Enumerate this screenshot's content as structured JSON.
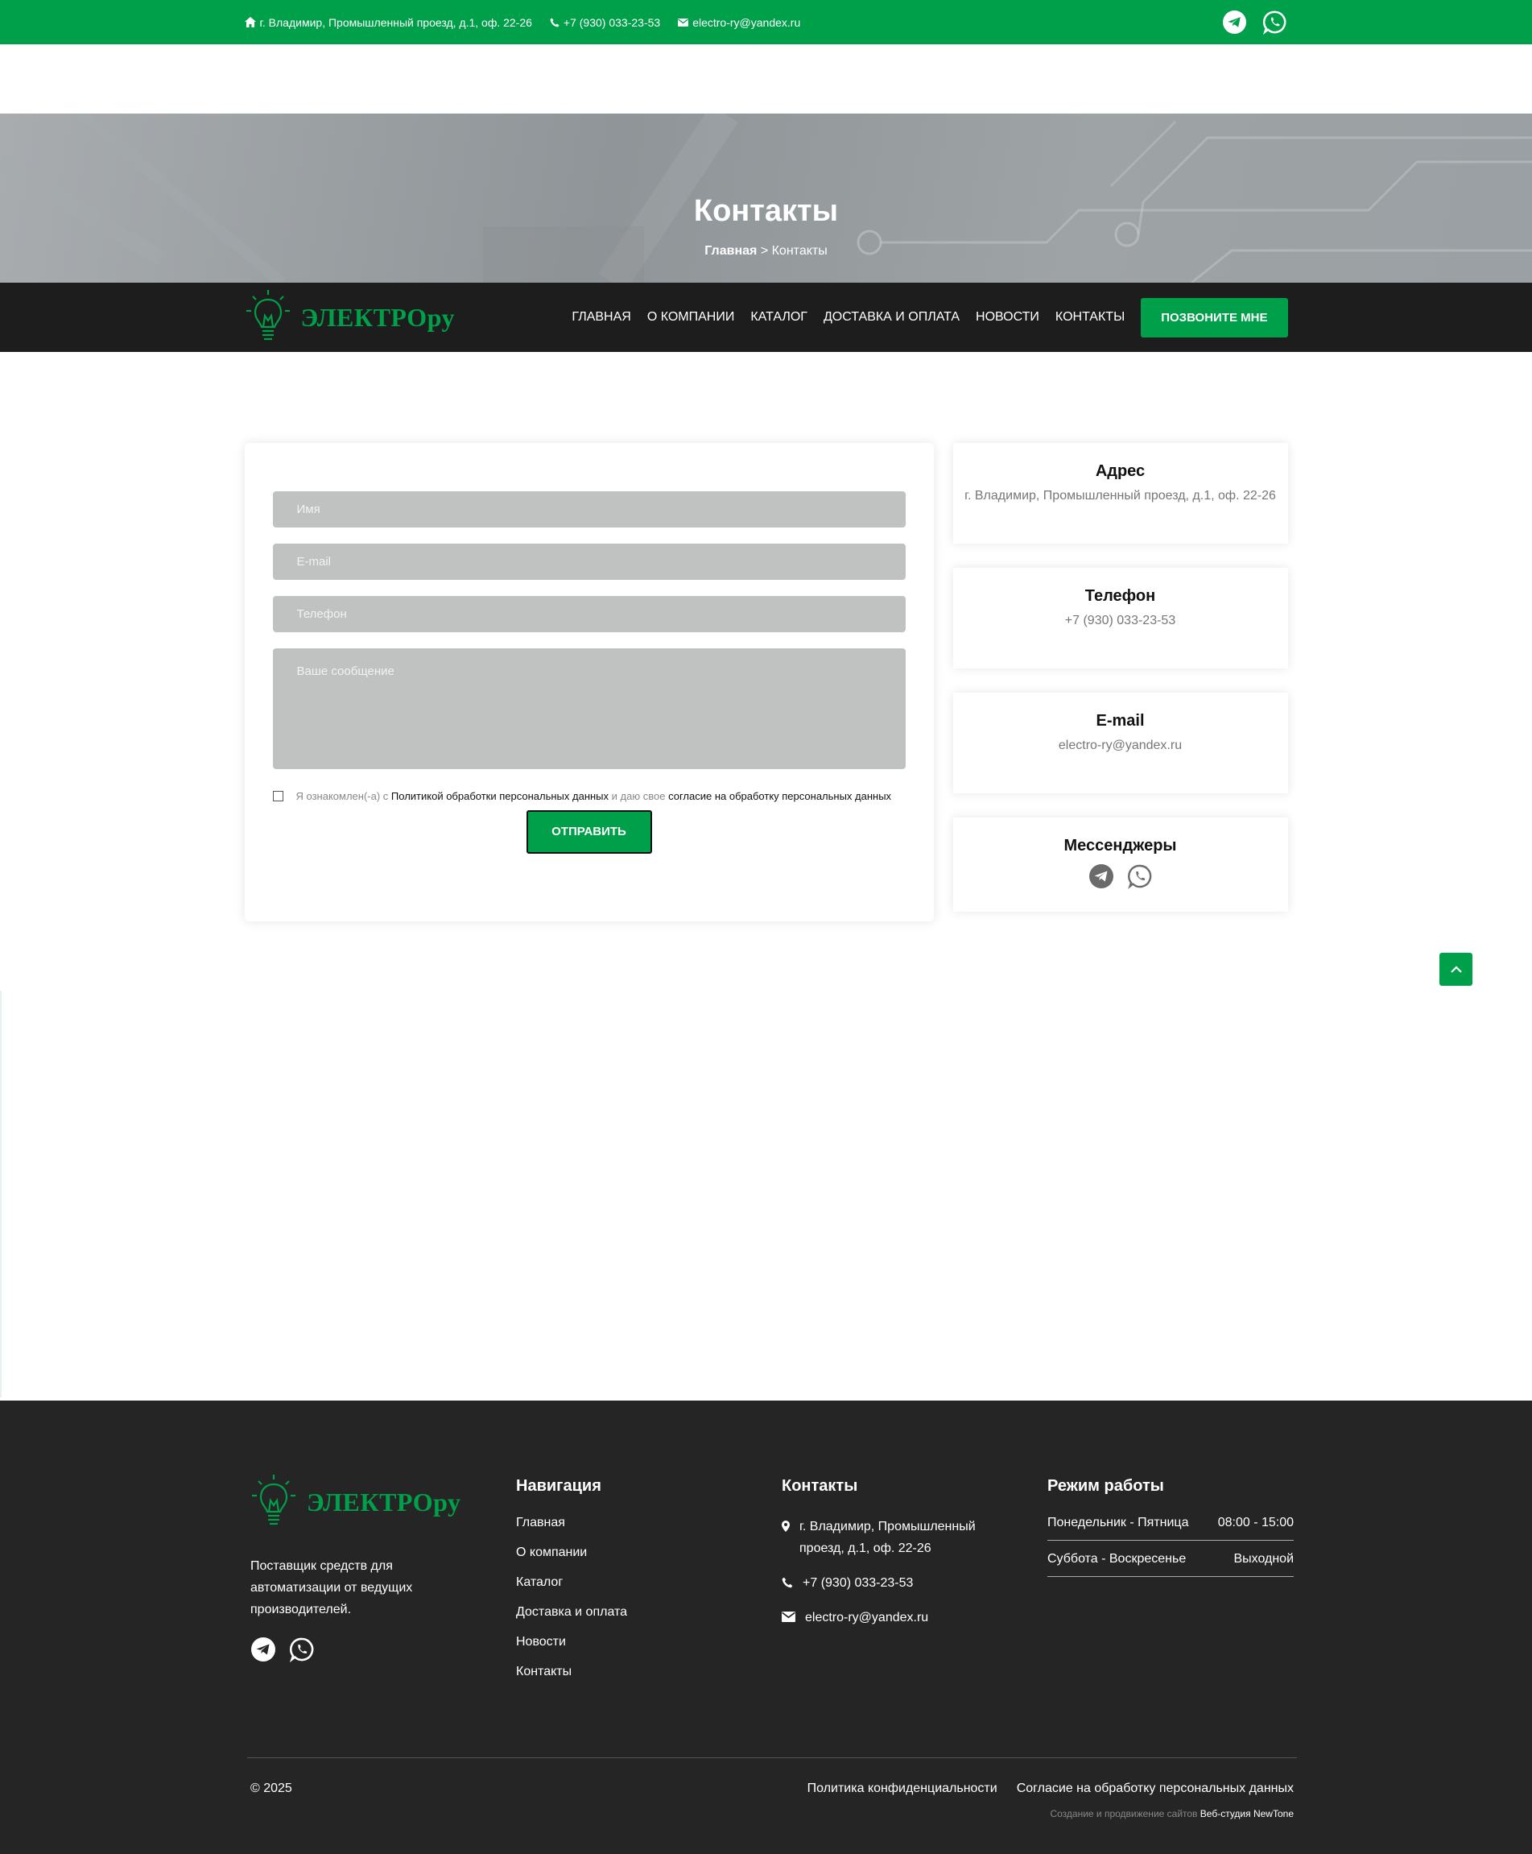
{
  "topbar": {
    "address": "г. Владимир, Промышленный проезд, д.1, оф. 22-26",
    "phone": "+7 (930) 033-23-53",
    "email": "electro-ry@yandex.ru"
  },
  "hero": {
    "title": "Контакты",
    "breadcrumb_home": "Главная",
    "breadcrumb_sep": ">",
    "breadcrumb_current": "Контакты"
  },
  "navbar": {
    "logo_text": "ЭЛЕКТРОру",
    "items": [
      {
        "label": "ГЛАВНАЯ"
      },
      {
        "label": "О КОМПАНИИ"
      },
      {
        "label": "КАТАЛОГ"
      },
      {
        "label": "ДОСТАВКА И ОПЛАТА"
      },
      {
        "label": "НОВОСТИ"
      },
      {
        "label": "КОНТАКТЫ"
      }
    ],
    "call_button": "ПОЗВОНИТЕ МНЕ"
  },
  "form": {
    "name_placeholder": "Имя",
    "email_placeholder": "E-mail",
    "phone_placeholder": "Телефон",
    "message_placeholder": "Ваше сообщение",
    "agree_prefix": "Я ознакомлен(-а) с",
    "agree_policy_link": "Политикой обработки персональных данных",
    "agree_middle": "и даю свое",
    "agree_consent_link": "согласие на обработку персональных данных",
    "submit": "ОТПРАВИТЬ"
  },
  "info": {
    "address_title": "Адрес",
    "address_value": "г. Владимир, Промышленный проезд, д.1, оф. 22-26",
    "phone_title": "Телефон",
    "phone_value": "+7 (930) 033-23-53",
    "email_title": "E-mail",
    "email_value": "electro-ry@yandex.ru",
    "messengers_title": "Мессенджеры"
  },
  "footer": {
    "logo_text": "ЭЛЕКТРОру",
    "description": "Поставщик средств для автоматизации от ведущих производителей.",
    "nav_title": "Навигация",
    "nav_links": [
      {
        "label": "Главная"
      },
      {
        "label": "О компании"
      },
      {
        "label": "Каталог"
      },
      {
        "label": "Доставка и оплата"
      },
      {
        "label": "Новости"
      },
      {
        "label": "Контакты"
      }
    ],
    "contacts_title": "Контакты",
    "contact_address": "г. Владимир, Промышленный проезд, д.1, оф. 22-26",
    "contact_phone": "+7 (930) 033-23-53",
    "contact_email": "electro-ry@yandex.ru",
    "hours_title": "Режим работы",
    "hours": [
      {
        "days": "Понедельник - Пятница",
        "time": "08:00 - 15:00"
      },
      {
        "days": "Суббота - Воскресенье",
        "time": "Выходной"
      }
    ],
    "copyright": "© 2025",
    "privacy": "Политика конфиденциальности",
    "consent": "Согласие на обработку персональных данных",
    "studio_prefix": "Создание и продвижение сайтов",
    "studio_name": "Веб-студия NewTone"
  },
  "colors": {
    "accent": "#00a04a",
    "dark": "#1d1d1d",
    "footer": "#252525"
  }
}
